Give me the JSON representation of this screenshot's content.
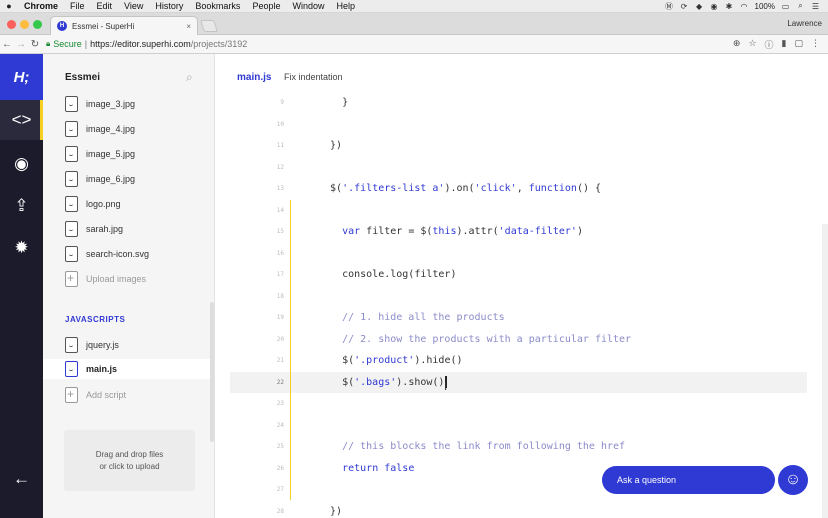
{
  "menubar": {
    "apple": "",
    "items": [
      "Chrome",
      "File",
      "Edit",
      "View",
      "History",
      "Bookmarks",
      "People",
      "Window",
      "Help"
    ],
    "battery": "100%",
    "user": "Lawrence"
  },
  "browser": {
    "tab_title": "Essmei - SuperHi",
    "tab_close": "×",
    "profile": "Lawrence",
    "secure_label": "Secure",
    "url_base": "https://editor.superhi.com",
    "url_path": "/projects/3192"
  },
  "rail": {
    "logo": "H;",
    "icons": [
      "code-icon",
      "eye-icon",
      "upload-icon",
      "gear-icon",
      "back-arrow-icon"
    ],
    "accent_color": "#f5d020",
    "brand_color": "#2f39d3"
  },
  "sidebar": {
    "project": "Essmei",
    "files": [
      {
        "name": "image_3.jpg"
      },
      {
        "name": "image_4.jpg"
      },
      {
        "name": "image_5.jpg"
      },
      {
        "name": "image_6.jpg"
      },
      {
        "name": "logo.png"
      },
      {
        "name": "sarah.jpg"
      },
      {
        "name": "search-icon.svg"
      }
    ],
    "upload_images": "Upload images",
    "section_js": "JAVASCRIPTS",
    "scripts": [
      {
        "name": "jquery.js"
      },
      {
        "name": "main.js"
      }
    ],
    "add_script": "Add script",
    "drop_line1": "Drag and drop files",
    "drop_line2": "or click to upload"
  },
  "editor": {
    "filename": "main.js",
    "action": "Fix indentation",
    "active_line": 22,
    "lines": [
      {
        "n": "9",
        "text": "    }"
      },
      {
        "n": "10",
        "text": ""
      },
      {
        "n": "11",
        "text": "  })"
      },
      {
        "n": "12",
        "text": ""
      },
      {
        "n": "13",
        "text": "  $('.filters-list a').on('click', function() {"
      },
      {
        "n": "14",
        "text": ""
      },
      {
        "n": "15",
        "text": "    var filter = $(this).attr('data-filter')"
      },
      {
        "n": "16",
        "text": ""
      },
      {
        "n": "17",
        "text": "    console.log(filter)"
      },
      {
        "n": "18",
        "text": ""
      },
      {
        "n": "19",
        "text": "    // 1. hide all the products"
      },
      {
        "n": "20",
        "text": "    // 2. show the products with a particular filter"
      },
      {
        "n": "21",
        "text": "    $('.product').hide()"
      },
      {
        "n": "22",
        "text": "    $('.bags').show()"
      },
      {
        "n": "23",
        "text": ""
      },
      {
        "n": "24",
        "text": ""
      },
      {
        "n": "25",
        "text": "    // this blocks the link from following the href"
      },
      {
        "n": "26",
        "text": "    return false"
      },
      {
        "n": "27",
        "text": ""
      },
      {
        "n": "28",
        "text": "  })"
      }
    ]
  },
  "help": {
    "ask_label": "Ask a question"
  }
}
